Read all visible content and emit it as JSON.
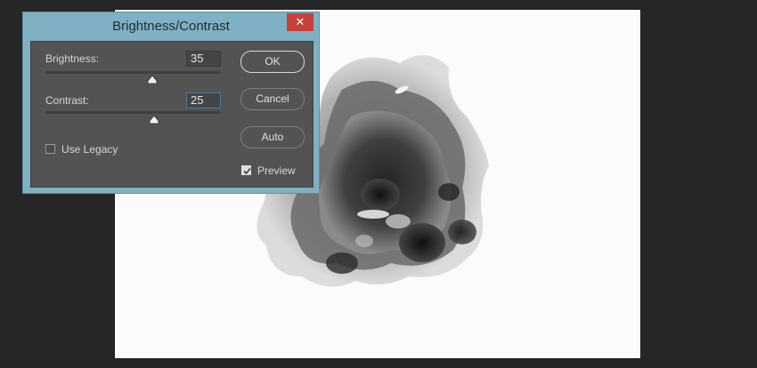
{
  "dialog": {
    "title": "Brightness/Contrast",
    "close_icon": "close-icon",
    "brightness": {
      "label": "Brightness:",
      "value": "35"
    },
    "contrast": {
      "label": "Contrast:",
      "value": "25"
    },
    "use_legacy": {
      "label": "Use Legacy",
      "checked": false
    },
    "preview": {
      "label": "Preview",
      "checked": true
    },
    "buttons": {
      "ok": "OK",
      "cancel": "Cancel",
      "auto": "Auto"
    }
  },
  "colors": {
    "dialog_frame": "#7fb0c4",
    "panel": "#535353",
    "close_button": "#c7403a",
    "workspace": "#262626",
    "canvas": "#fbfbfb"
  },
  "canvas": {
    "content": "watercolor-ink-blot"
  }
}
